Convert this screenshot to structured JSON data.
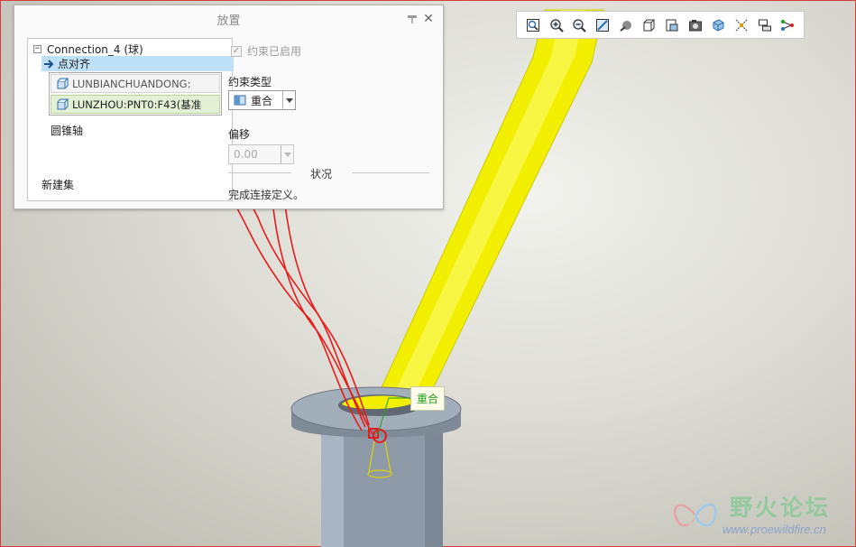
{
  "dialog": {
    "title": "放置",
    "close": "✕",
    "tree": {
      "root_label": "Connection_4 (球)",
      "root_expander": "−",
      "selected_constraint": "点对齐",
      "ref_1": "LUNBIANCHUANDONG:",
      "ref_2": "LUNZHOU:PNT0:F43(基准",
      "cone_axis": "圆锥轴",
      "new_set": "新建集"
    },
    "enabled_label": "约束已启用",
    "enabled_mark": "✓",
    "constraint_type_label": "约束类型",
    "constraint_type_value": "重合",
    "offset_label": "偏移",
    "offset_value": "0.00",
    "status_label": "状况",
    "status_text": "完成连接定义。"
  },
  "viewport": {
    "tag_label": "重合"
  },
  "toolbar": {
    "icons": [
      "refit-icon",
      "zoom-in-icon",
      "zoom-out-icon",
      "repaint-icon",
      "display-style-icon",
      "standard-orientation-icon",
      "saved-views-icon",
      "view-manager-icon",
      "spin-center-icon",
      "datum-display-icon",
      "annotation-display-icon",
      "point-display-icon"
    ]
  },
  "watermark": {
    "text_cn": "野火论坛",
    "url": "www.proewildfire.cn"
  },
  "colors": {
    "shaft": "#f2f000",
    "bushing": "#8c99a8",
    "annotation_red": "#e51c1c",
    "selection_blue": "#bfe1f7"
  }
}
